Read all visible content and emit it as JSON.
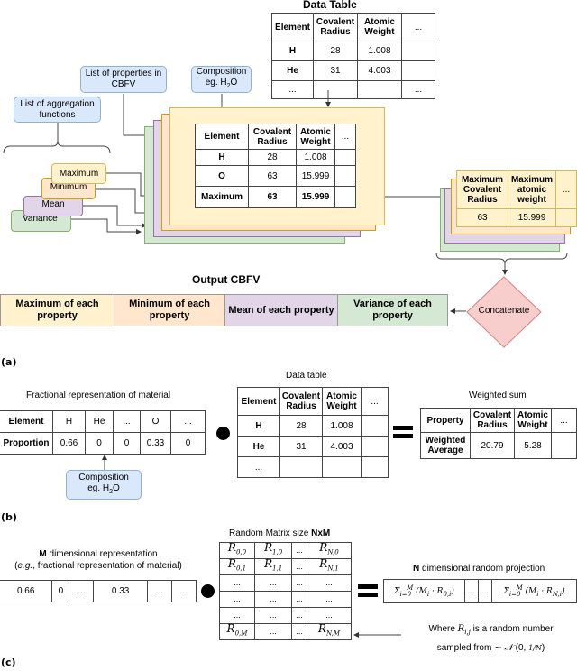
{
  "panel_a": {
    "label": "(a)",
    "data_table": {
      "title": "Data Table",
      "headers": [
        "Element",
        "Covalent Radius",
        "Atomic Weight",
        "..."
      ],
      "rows": [
        [
          "H",
          "28",
          "1.008",
          ""
        ],
        [
          "He",
          "31",
          "4.003",
          ""
        ],
        [
          "...",
          "",
          "",
          "..."
        ]
      ]
    },
    "callouts": {
      "properties": "List of properties in CBFV",
      "composition_line1": "Composition",
      "composition_line2": "eg. H",
      "composition_sub": "2",
      "composition_tail": "O",
      "aggregation": "List of aggregation functions"
    },
    "aggregations": [
      "Maximum",
      "Minimum",
      "Mean",
      "Variance"
    ],
    "stack_table": {
      "headers": [
        "Element",
        "Covalent Radius",
        "Atomic Weight",
        "..."
      ],
      "rows": [
        [
          "H",
          "28",
          "1.008",
          ""
        ],
        [
          "O",
          "63",
          "15.999",
          ""
        ],
        [
          "Maximum",
          "63",
          "15.999",
          ""
        ]
      ]
    },
    "result_table": {
      "headers": [
        "Maximum Covalent Radius",
        "Maximum atomic weight",
        "..."
      ],
      "values": [
        "63",
        "15.999",
        ""
      ]
    },
    "concatenate": "Concatenate",
    "output": {
      "title": "Output CBFV",
      "segments": [
        "Maximum of each property",
        "Minimum of each property",
        "Mean of each property",
        "Variance of each property"
      ]
    },
    "colors": {
      "max": "#fff2cc",
      "max_border": "#d6b656",
      "min": "#ffe6cc",
      "min_border": "#d79b00",
      "mean": "#e1d5e7",
      "mean_border": "#9673a6",
      "var": "#d5e8d4",
      "var_border": "#82b366",
      "callout": "#dae8fc",
      "concat": "#f8cecc"
    }
  },
  "panel_b": {
    "label": "(b)",
    "fractional": {
      "title": "Fractional representation of material",
      "row1": [
        "Element",
        "H",
        "He",
        "...",
        "O",
        "..."
      ],
      "row2": [
        "Proportion",
        "0.66",
        "0",
        "0",
        "0.33",
        "0"
      ]
    },
    "composition_line1": "Composition",
    "composition_line2": "eg. H",
    "composition_sub": "2",
    "composition_tail": "O",
    "data_table": {
      "title": "Data table",
      "headers": [
        "Element",
        "Covalent Radius",
        "Atomic Weight",
        "..."
      ],
      "rows": [
        [
          "H",
          "28",
          "1.008",
          ""
        ],
        [
          "He",
          "31",
          "4.003",
          ""
        ],
        [
          "...",
          "",
          "",
          ""
        ]
      ]
    },
    "weighted": {
      "title": "Weighted sum",
      "headers": [
        "Property",
        "Covalent Radius",
        "Atomic Weight",
        "..."
      ],
      "row": [
        "Weighted Average",
        "20.79",
        "5.28",
        ""
      ]
    }
  },
  "panel_c": {
    "label": "(c)",
    "m_repr": {
      "title_bold": "M",
      "title_rest": " dimensional representation",
      "subtitle_italic": "e.g.",
      "subtitle_rest": ", fractional representation of material)",
      "values": [
        "0.66",
        "0",
        "...",
        "0.33",
        "...",
        "..."
      ]
    },
    "matrix": {
      "title_pre": "Random Matrix size ",
      "title_bold": "NxM",
      "rows": [
        [
          "R_{0,0}",
          "R_{1,0}",
          "...",
          "R_{N,0}"
        ],
        [
          "R_{0,1}",
          "R_{1,1}",
          "...",
          "R_{N,1}"
        ],
        [
          "...",
          "...",
          "...",
          "..."
        ],
        [
          "...",
          "...",
          "...",
          "..."
        ],
        [
          "...",
          "...",
          "...",
          "..."
        ],
        [
          "R_{0,M}",
          "...",
          "...",
          "R_{N,M}"
        ]
      ]
    },
    "projection": {
      "title_bold": "N",
      "title_rest": " dimensional random projection",
      "cells": [
        "Σ_{i=0}^{M} (M_i · R_{0,i})",
        "...",
        "...",
        "Σ_{i=0}^{M} (M_i · R_{N,i})"
      ]
    },
    "note_line1": "Where R_{i,j} is a random number",
    "note_line2": "sampled from ∼ 𝒩 (0, 1/N)"
  }
}
